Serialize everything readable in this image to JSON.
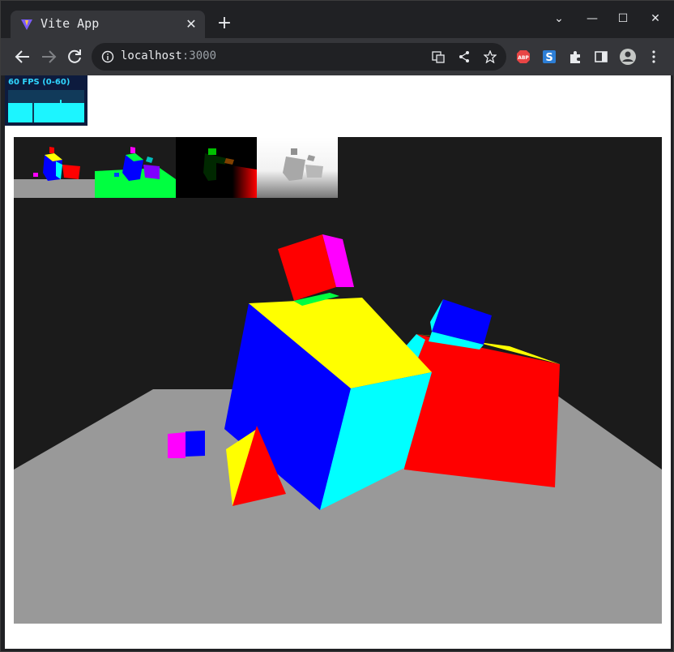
{
  "browser": {
    "tab": {
      "title": "Vite App",
      "close_glyph": "✕"
    },
    "new_tab_glyph": "+",
    "window_controls": {
      "dropdown": "⌄",
      "minimize": "—",
      "maximize": "☐",
      "close": "✕"
    },
    "address": {
      "host": "localhost",
      "port": ":3000"
    },
    "extensions": [
      {
        "name": "abp-icon",
        "label": "ABP",
        "color": "#e84545"
      },
      {
        "name": "s-extension-icon",
        "label": "S",
        "color": "#2c7ed6"
      }
    ]
  },
  "stats": {
    "label": "60 FPS (0-60)"
  },
  "scene": {
    "background": "#1b1b1b",
    "floor_color": "#999999",
    "previews": [
      "color",
      "normal",
      "velocity",
      "depth"
    ]
  },
  "colors": {
    "accent": "#30d5ff",
    "red": "#ff0000",
    "yellow": "#ffff00",
    "blue": "#0000ff",
    "cyan": "#00ffff",
    "magenta": "#ff00ff",
    "green": "#00ff40"
  }
}
